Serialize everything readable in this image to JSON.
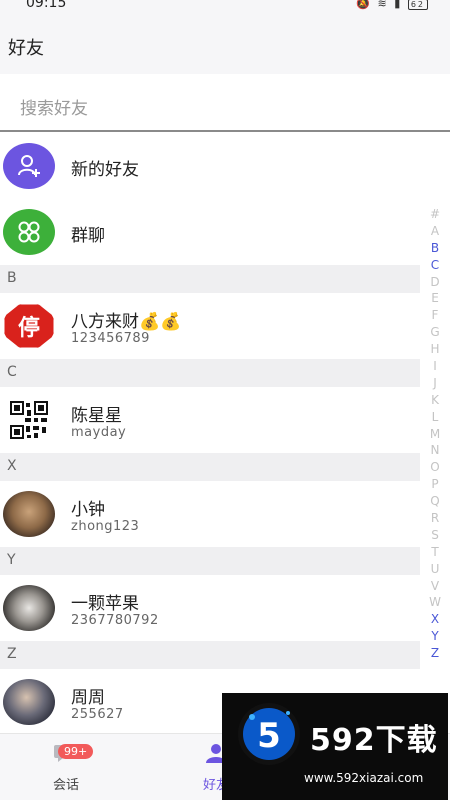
{
  "status": {
    "time": "09:15",
    "battery": "62"
  },
  "header": {
    "title": "好友"
  },
  "search": {
    "placeholder": "搜索好友"
  },
  "specials": [
    {
      "label": "新的好友",
      "color": "#6c55e0"
    },
    {
      "label": "群聊",
      "color": "#3db03a"
    }
  ],
  "sections": [
    {
      "letter": "B",
      "name": "八方来财💰💰",
      "sub": "123456789"
    },
    {
      "letter": "C",
      "name": "陈星星",
      "sub": "mayday"
    },
    {
      "letter": "X",
      "name": "小钟",
      "sub": "zhong123"
    },
    {
      "letter": "Y",
      "name": "一颗苹果",
      "sub": "2367780792"
    },
    {
      "letter": "Z",
      "name": "周周",
      "sub": "255627"
    }
  ],
  "index_letters": [
    "#",
    "A",
    "B",
    "C",
    "D",
    "E",
    "F",
    "G",
    "H",
    "I",
    "J",
    "K",
    "L",
    "M",
    "N",
    "O",
    "P",
    "Q",
    "R",
    "S",
    "T",
    "U",
    "V",
    "W",
    "X",
    "Y",
    "Z"
  ],
  "index_active": [
    "B",
    "C",
    "X",
    "Y",
    "Z"
  ],
  "contact_avatar": {
    "stop_sign_text": "停"
  },
  "bottom_nav": {
    "chats_label": "会话",
    "chats_badge": "99+",
    "friends_label": "好友"
  },
  "watermark": {
    "logo_digit": "5",
    "title": "592下载",
    "url": "www.592xiazai.com"
  },
  "colors": {
    "accent": "#4a57d6",
    "new_friend": "#6c55e0",
    "group_chat": "#3db03a",
    "badge": "#f25a5a",
    "stop_red": "#d9221c"
  }
}
